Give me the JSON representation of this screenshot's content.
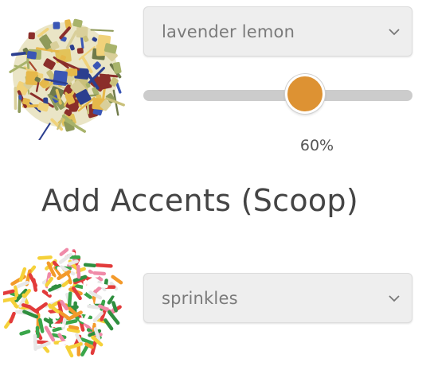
{
  "blend": {
    "image_name": "lavender-lemon-tea-image",
    "selected": "lavender lemon",
    "slider": {
      "value_percent": 60,
      "label": "60%",
      "accent": "#dd9233"
    }
  },
  "accents": {
    "heading": "Add Accents (Scoop)",
    "image_name": "sprinkles-image",
    "selected": "sprinkles"
  }
}
